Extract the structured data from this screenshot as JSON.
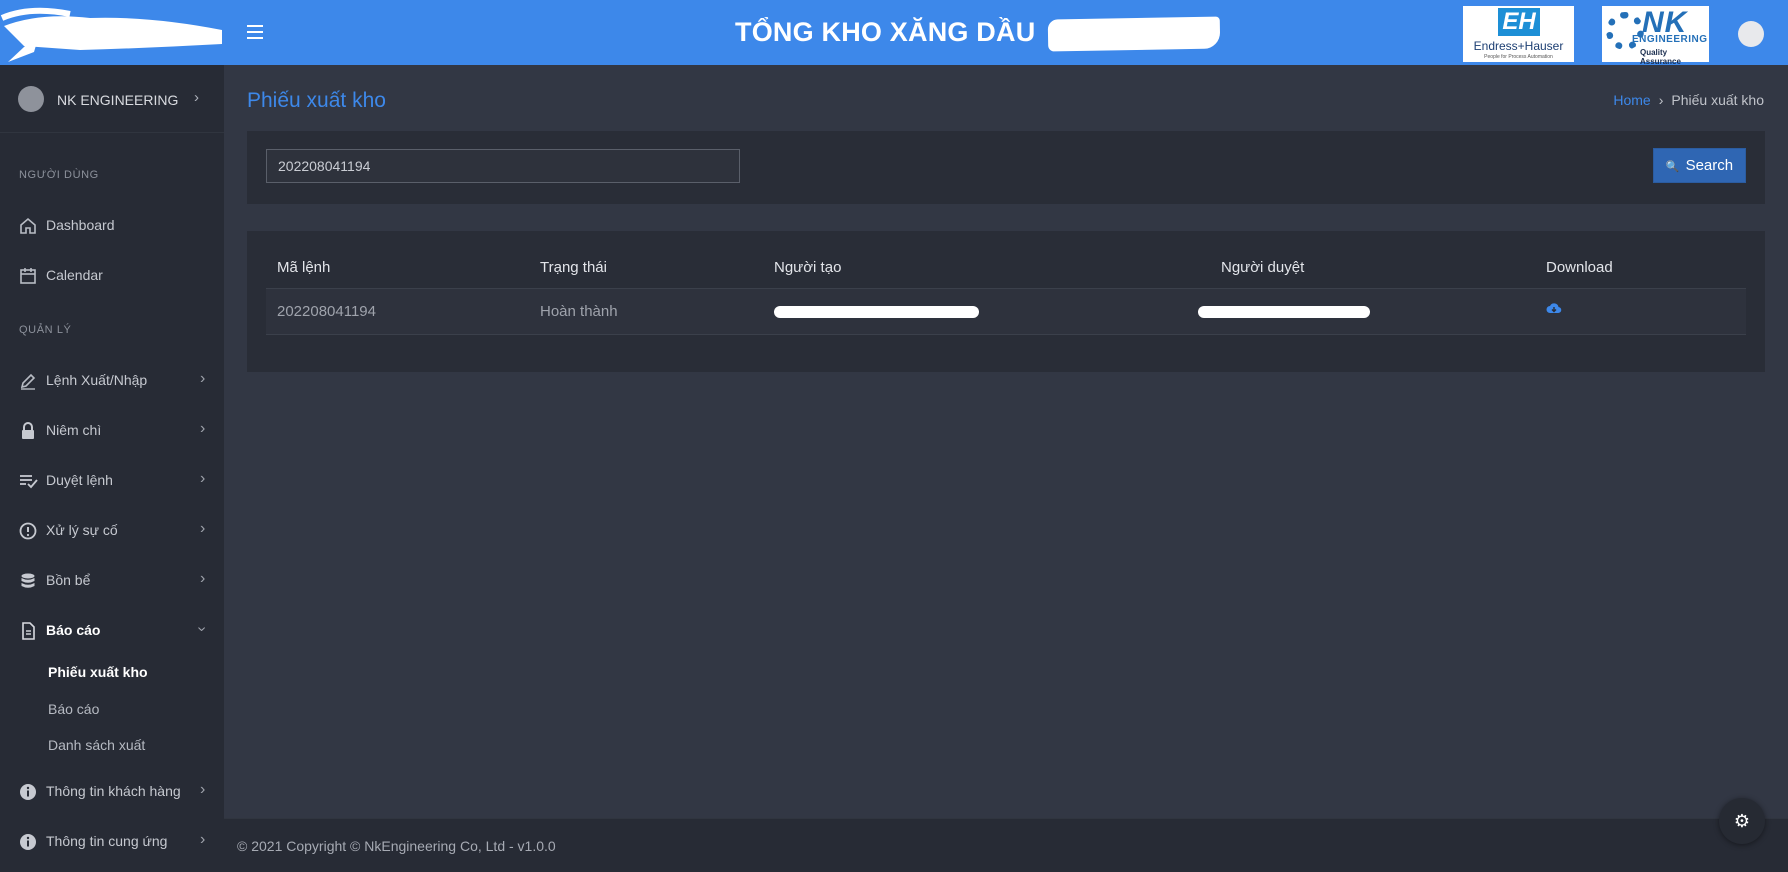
{
  "header": {
    "title": "TỔNG KHO XĂNG DẦU",
    "menu_icon": "hamburger-menu-icon",
    "logos": {
      "eh_mark": "EH",
      "eh_name": "Endress+Hauser",
      "eh_tagline": "People for Process Automation",
      "nk_mark": "NK",
      "nk_name": "ENGINEERING",
      "nk_tagline": "Quality Assurance"
    }
  },
  "sidebar": {
    "user_name": "NK ENGINEERING",
    "sections": {
      "user": "NGƯỜI DÙNG",
      "manage": "QUẢN LÝ"
    },
    "items": [
      {
        "label": "Dashboard",
        "icon": "home-icon"
      },
      {
        "label": "Calendar",
        "icon": "calendar-icon"
      },
      {
        "label": "Lệnh Xuất/Nhập",
        "icon": "pencil-icon"
      },
      {
        "label": "Niêm chì",
        "icon": "lock-icon"
      },
      {
        "label": "Duyệt lệnh",
        "icon": "playlist-check-icon"
      },
      {
        "label": "Xử lý sự cố",
        "icon": "alert-circle-icon"
      },
      {
        "label": "Bồn bể",
        "icon": "database-icon"
      },
      {
        "label": "Báo cáo",
        "icon": "file-document-icon"
      },
      {
        "label": "Thông tin khách hàng",
        "icon": "info-icon"
      },
      {
        "label": "Thông tin cung ứng",
        "icon": "info-icon"
      }
    ],
    "report_subitems": [
      "Phiếu xuất kho",
      "Báo cáo",
      "Danh sách xuất"
    ]
  },
  "page": {
    "title": "Phiếu xuất kho",
    "breadcrumb": {
      "home": "Home",
      "current": "Phiếu xuất kho"
    }
  },
  "search": {
    "value": "202208041194",
    "button_label": "Search"
  },
  "table": {
    "columns": [
      "Mã lệnh",
      "Trạng thái",
      "Người tạo",
      "Người duyệt",
      "Download"
    ],
    "rows": [
      {
        "code": "202208041194",
        "status": "Hoàn thành"
      }
    ]
  },
  "footer": {
    "text": "© 2021 Copyright © NkEngineering Co, Ltd - v1.0.0"
  },
  "colors": {
    "accent": "#3d88ea",
    "sidebar_bg": "#272b35",
    "content_bg": "#323744",
    "button_bg": "#2f66b3"
  }
}
